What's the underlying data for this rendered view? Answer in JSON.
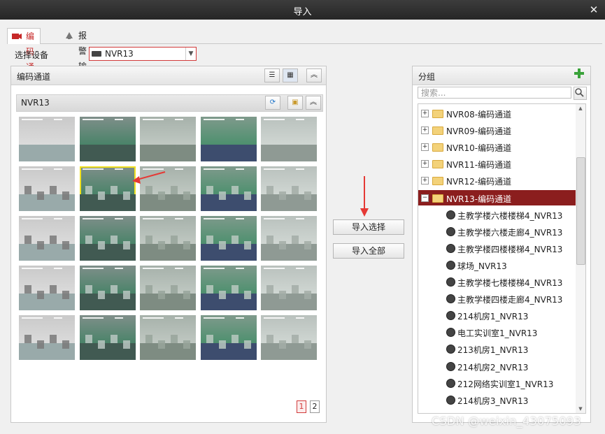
{
  "window": {
    "title": "导入"
  },
  "tabs": [
    {
      "label": "编码通道"
    },
    {
      "label": "报警输入"
    }
  ],
  "device_select": {
    "label": "选择设备",
    "value": "NVR13"
  },
  "channels_panel": {
    "title": "编码通道",
    "device_name": "NVR13"
  },
  "buttons": {
    "import_selected": "导入选择",
    "import_all": "导入全部"
  },
  "pagination": {
    "pages": [
      "1",
      "2"
    ],
    "current": "1"
  },
  "group_panel": {
    "title": "分组",
    "search_placeholder": "搜索...",
    "groups": [
      {
        "label": "NVR08-编码通道"
      },
      {
        "label": "NVR09-编码通道"
      },
      {
        "label": "NVR10-编码通道"
      },
      {
        "label": "NVR11-编码通道"
      },
      {
        "label": "NVR12-编码通道"
      },
      {
        "label": "NVR13-编码通道",
        "selected": true
      }
    ],
    "cameras": [
      "主教学楼六楼楼梯4_NVR13",
      "主教学楼六楼走廊4_NVR13",
      "主教学楼四楼楼梯4_NVR13",
      "球场_NVR13",
      "主教学楼七楼楼梯4_NVR13",
      "主教学楼四楼走廊4_NVR13",
      "214机房1_NVR13",
      "电工实训室1_NVR13",
      "213机房1_NVR13",
      "214机房2_NVR13",
      "212网络实训室1_NVR13",
      "214机房3_NVR13"
    ]
  },
  "watermark": "CSDN @weixin_43075093",
  "colors": {
    "accent": "#c62828",
    "selected_row": "#8b1e1e",
    "annotation_arrow": "#e53935",
    "highlight_frame": "#f0e020"
  }
}
